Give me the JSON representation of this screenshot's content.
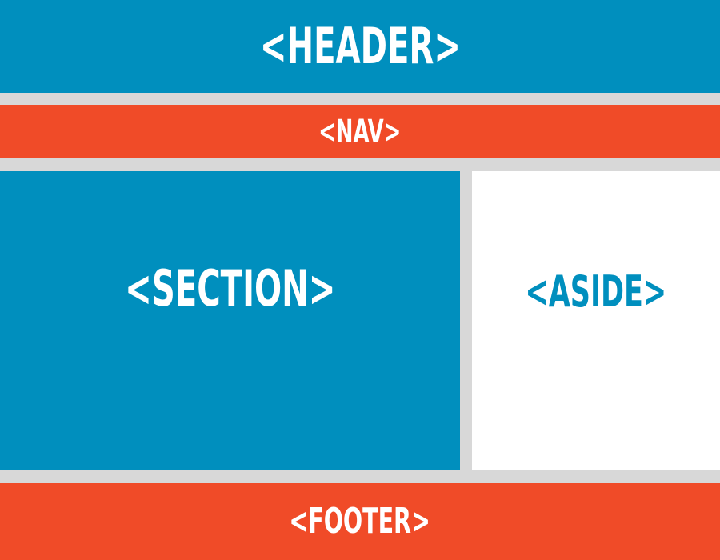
{
  "header": {
    "label": "<HEADER>"
  },
  "nav": {
    "label": "<NAV>"
  },
  "section": {
    "label": "<SECTION>"
  },
  "aside": {
    "label": "<ASIDE>"
  },
  "footer": {
    "label": "<FOOTER>"
  },
  "colors": {
    "blue": "#008fbe",
    "orange": "#f04b28",
    "white": "#ffffff",
    "gap": "#d8d8d8"
  }
}
